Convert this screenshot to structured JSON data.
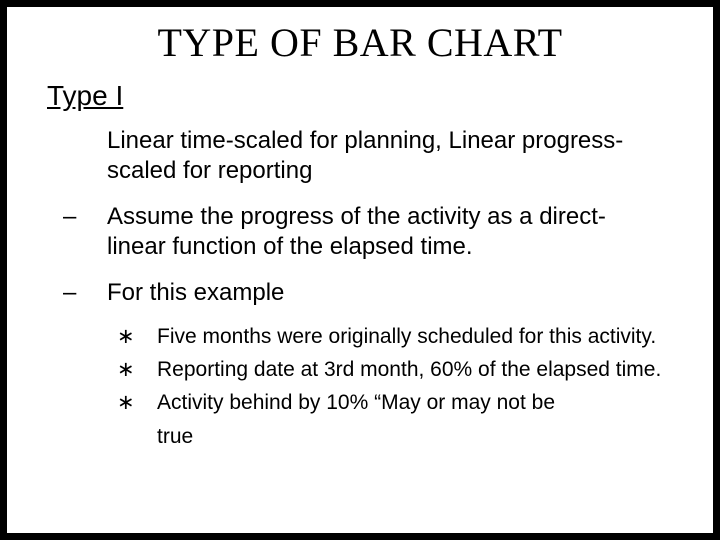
{
  "title": "TYPE OF BAR CHART",
  "subtitle": "Type I",
  "intro": "Linear time-scaled for planning, Linear progress-scaled for reporting",
  "points": {
    "p1": "Assume the progress of the activity as a direct-linear function of the elapsed time.",
    "p2": "For this example"
  },
  "sub": {
    "s1": "Five months were originally scheduled for this activity.",
    "s2": "Reporting date at 3rd month, 60% of the elapsed time.",
    "s3": "Activity behind by 10% “May or may not be"
  },
  "cutoff": "true"
}
